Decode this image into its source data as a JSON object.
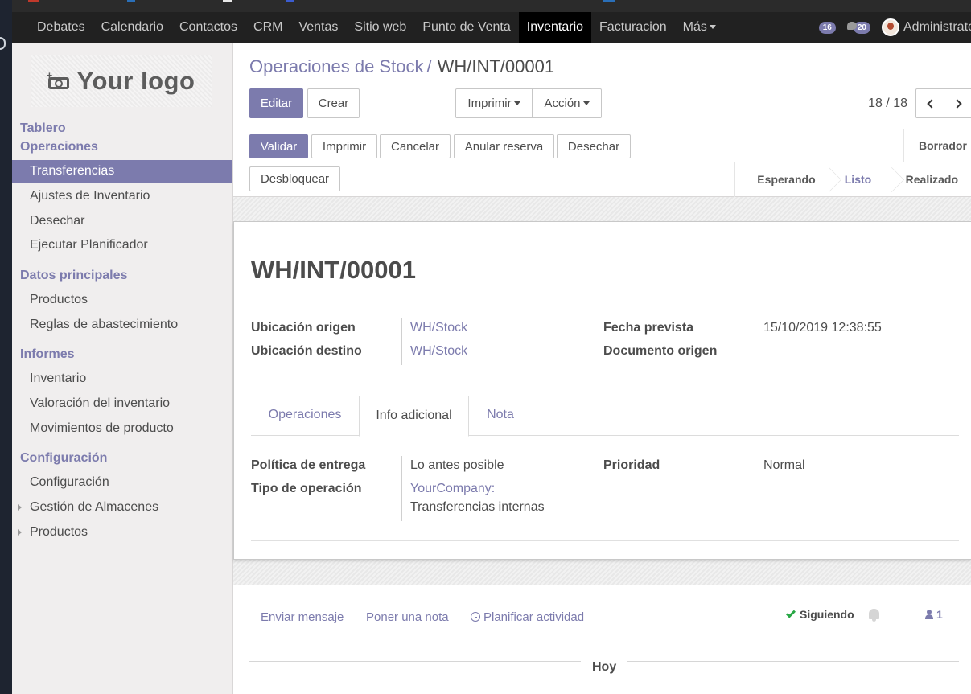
{
  "navbar": {
    "items": [
      {
        "label": "Debates"
      },
      {
        "label": "Calendario"
      },
      {
        "label": "Contactos"
      },
      {
        "label": "CRM"
      },
      {
        "label": "Ventas"
      },
      {
        "label": "Sitio web"
      },
      {
        "label": "Punto de Venta"
      },
      {
        "label": "Inventario",
        "active": true
      },
      {
        "label": "Facturacion"
      },
      {
        "label": "Más"
      }
    ],
    "activity_count": "16",
    "message_count": "20",
    "user_name": "Administrator"
  },
  "sidebar": {
    "logo_text": "Your logo",
    "top_link": "Tablero",
    "sections": [
      {
        "title": "Operaciones",
        "items": [
          "Transferencias",
          "Ajustes de Inventario",
          "Desechar",
          "Ejecutar Planificador"
        ]
      },
      {
        "title": "Datos principales",
        "items": [
          "Productos",
          "Reglas de abastecimiento"
        ]
      },
      {
        "title": "Informes",
        "items": [
          "Inventario",
          "Valoración del inventario",
          "Movimientos de producto"
        ]
      },
      {
        "title": "Configuración",
        "items": [
          "Configuración",
          "Gestión de Almacenes",
          "Productos"
        ]
      }
    ]
  },
  "breadcrumb": {
    "parent": "Operaciones de Stock",
    "separator": "/",
    "current": "WH/INT/00001"
  },
  "control": {
    "edit": "Editar",
    "create": "Crear",
    "print": "Imprimir",
    "action": "Acción",
    "pager": "18 / 18"
  },
  "statusbar": {
    "buttons": [
      "Validar",
      "Imprimir",
      "Cancelar",
      "Anular reserva",
      "Desechar",
      "Desbloquear"
    ],
    "draft": "Borrador",
    "stages": [
      "Esperando",
      "Listo",
      "Realizado"
    ],
    "current_stage": "Listo"
  },
  "form": {
    "title": "WH/INT/00001",
    "fields": {
      "origin_location_label": "Ubicación origen",
      "origin_location": "WH/Stock",
      "dest_location_label": "Ubicación destino",
      "dest_location": "WH/Stock",
      "scheduled_label": "Fecha prevista",
      "scheduled": "15/10/2019 12:38:55",
      "source_doc_label": "Documento origen",
      "source_doc": ""
    },
    "tabs": [
      "Operaciones",
      "Info adicional",
      "Nota"
    ],
    "active_tab": "Info adicional",
    "extra": {
      "delivery_policy_label": "Política de entrega",
      "delivery_policy": "Lo antes posible",
      "op_type_label": "Tipo de operación",
      "op_type_company": "YourCompany:",
      "op_type_name": "Transferencias internas",
      "priority_label": "Prioridad",
      "priority": "Normal"
    }
  },
  "chatter": {
    "send_message": "Enviar mensaje",
    "log_note": "Poner una nota",
    "schedule_activity": "Planificar actividad",
    "following": "Siguiendo",
    "followers_count": "1",
    "day_label": "Hoy"
  },
  "colors": {
    "accent": "#7c7bad",
    "navbar": "#212121",
    "success": "#28a745"
  }
}
